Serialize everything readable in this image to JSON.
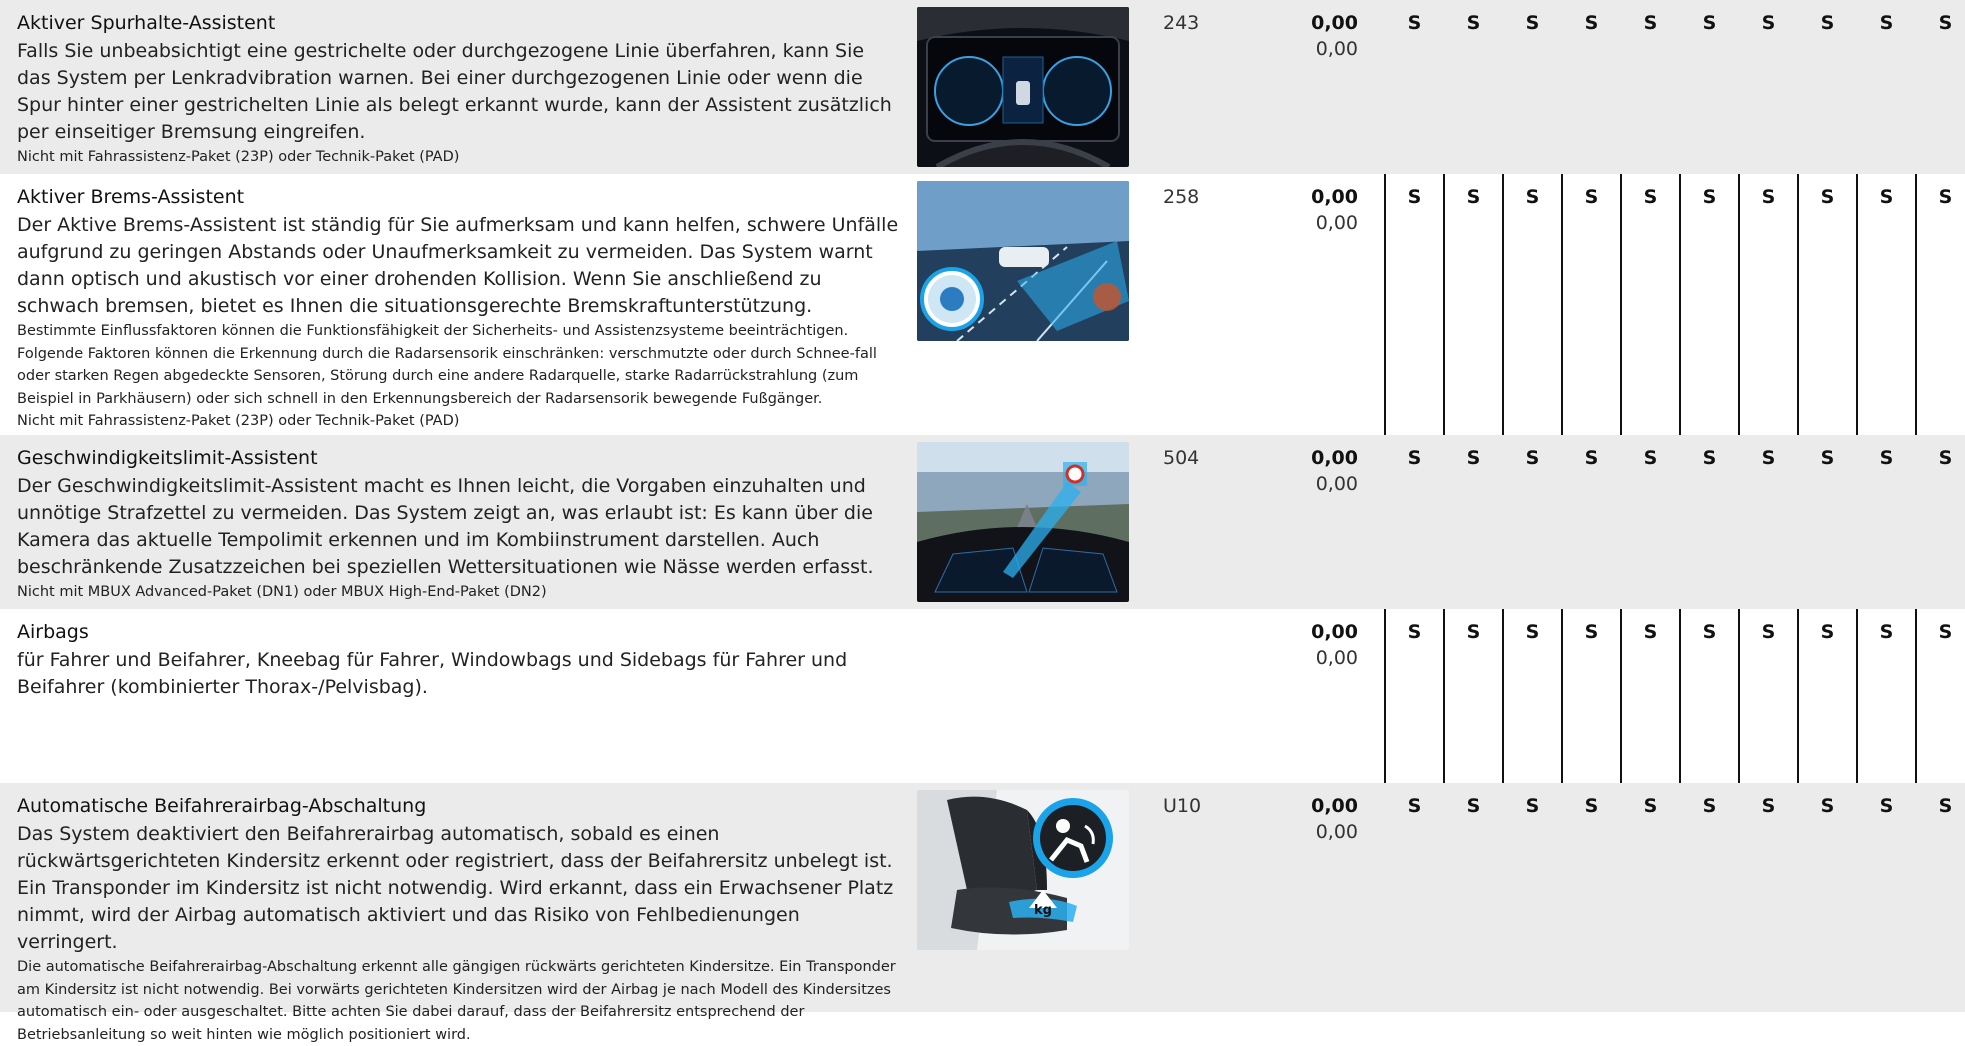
{
  "rows": [
    {
      "title": "Aktiver Spurhalte-Assistent",
      "description": "Falls Sie unbeabsichtigt eine gestrichelte oder durchgezogene Linie überfahren, kann Sie das System per Lenkradvibration warnen. Bei einer durchgezogenen Linie oder wenn die Spur hinter einer gestrichelten Linie als belegt erkannt wurde, kann der Assistent zusätzlich per einseitiger Bremsung eingreifen.",
      "notes": [
        "Nicht mit Fahrassistenz-Paket (23P) oder Technik-Paket (PAD)"
      ],
      "code": "243",
      "price_net": "0,00",
      "price_gross": "0,00",
      "image": "instrument-cluster-image",
      "standard": [
        "S",
        "S",
        "S",
        "S",
        "S",
        "S",
        "S",
        "S",
        "S",
        "S"
      ]
    },
    {
      "title": "Aktiver Brems-Assistent",
      "description": "Der Aktive Brems-Assistent ist ständig für Sie aufmerksam und kann helfen, schwere Unfälle aufgrund zu geringen Abstands oder Unaufmerksamkeit zu vermeiden. Das System warnt dann optisch und akustisch vor einer drohenden Kollision. Wenn Sie anschließend zu schwach bremsen, bietet es Ihnen die situationsgerechte Bremskraftunterstützung.",
      "notes": [
        "Bestimmte Einflussfaktoren können die Funktionsfähigkeit der Sicherheits- und Assistenzsysteme beeinträchtigen. Folgende Faktoren können die Erkennung durch die Radarsensorik einschränken: verschmutzte oder durch Schnee-fall oder starken Regen abgedeckte Sensoren, Störung durch eine andere Radarquelle, starke Radarrückstrahlung (zum Beispiel in Parkhäusern) oder sich schnell in den Erkennungsbereich der Radarsensorik bewegende Fußgänger.",
        "Nicht mit Fahrassistenz-Paket (23P) oder Technik-Paket (PAD)"
      ],
      "code": "258",
      "price_net": "0,00",
      "price_gross": "0,00",
      "image": "brake-assist-image",
      "standard": [
        "S",
        "S",
        "S",
        "S",
        "S",
        "S",
        "S",
        "S",
        "S",
        "S"
      ]
    },
    {
      "title": "Geschwindigkeitslimit-Assistent",
      "description": "Der Geschwindigkeitslimit-Assistent macht es Ihnen leicht, die Vorgaben einzuhalten und unnötige Strafzettel zu vermeiden. Das System zeigt an, was erlaubt ist: Es kann über die Kamera das aktuelle Tempolimit erkennen und im Kombiinstrument darstellen. Auch beschränkende Zusatzzeichen bei speziellen Wettersituationen wie Nässe werden erfasst.",
      "notes": [
        "Nicht mit MBUX Advanced-Paket (DN1) oder MBUX High-End-Paket (DN2)"
      ],
      "code": "504",
      "price_net": "0,00",
      "price_gross": "0,00",
      "image": "speed-limit-image",
      "standard": [
        "S",
        "S",
        "S",
        "S",
        "S",
        "S",
        "S",
        "S",
        "S",
        "S"
      ]
    },
    {
      "title": "Airbags",
      "description": "für Fahrer und Beifahrer, Kneebag für Fahrer, Windowbags und Sidebags für Fahrer und Beifahrer (kombinierter Thorax-/Pelvisbag).",
      "notes": [],
      "code": "",
      "price_net": "0,00",
      "price_gross": "0,00",
      "image": "",
      "standard": [
        "S",
        "S",
        "S",
        "S",
        "S",
        "S",
        "S",
        "S",
        "S",
        "S"
      ]
    },
    {
      "title": "Automatische Beifahrerairbag-Abschaltung",
      "description": "Das System deaktiviert den Beifahrerairbag automatisch, sobald es einen rückwärtsgerichteten Kindersitz erkennt oder registriert, dass der Beifahrersitz unbelegt ist. Ein Transponder im Kindersitz ist nicht notwendig. Wird erkannt, dass ein Erwachsener Platz nimmt, wird der Airbag automatisch aktiviert und das Risiko von Fehlbedienungen verringert.",
      "notes": [
        "Die automatische Beifahrerairbag-Abschaltung erkennt alle gängigen rückwärts gerichteten Kindersitze. Ein Transponder am Kindersitz ist nicht notwendig. Bei vorwärts gerichteten Kindersitzen wird der Airbag je nach Modell des Kindersitzes automatisch ein- oder ausgeschaltet. Bitte achten Sie dabei darauf, dass der Beifahrersitz entsprechend der Betriebsanleitung so weit hinten wie möglich positioniert wird."
      ],
      "code": "U10",
      "price_net": "0,00",
      "price_gross": "0,00",
      "image": "airbag-seat-image",
      "image_badge": "kg",
      "standard": [
        "S",
        "S",
        "S",
        "S",
        "S",
        "S",
        "S",
        "S",
        "S",
        "S"
      ]
    }
  ],
  "colors": {
    "row_shade": "#ebebeb",
    "grid_line": "#111111",
    "accent_blue": "#1aa3e8"
  }
}
